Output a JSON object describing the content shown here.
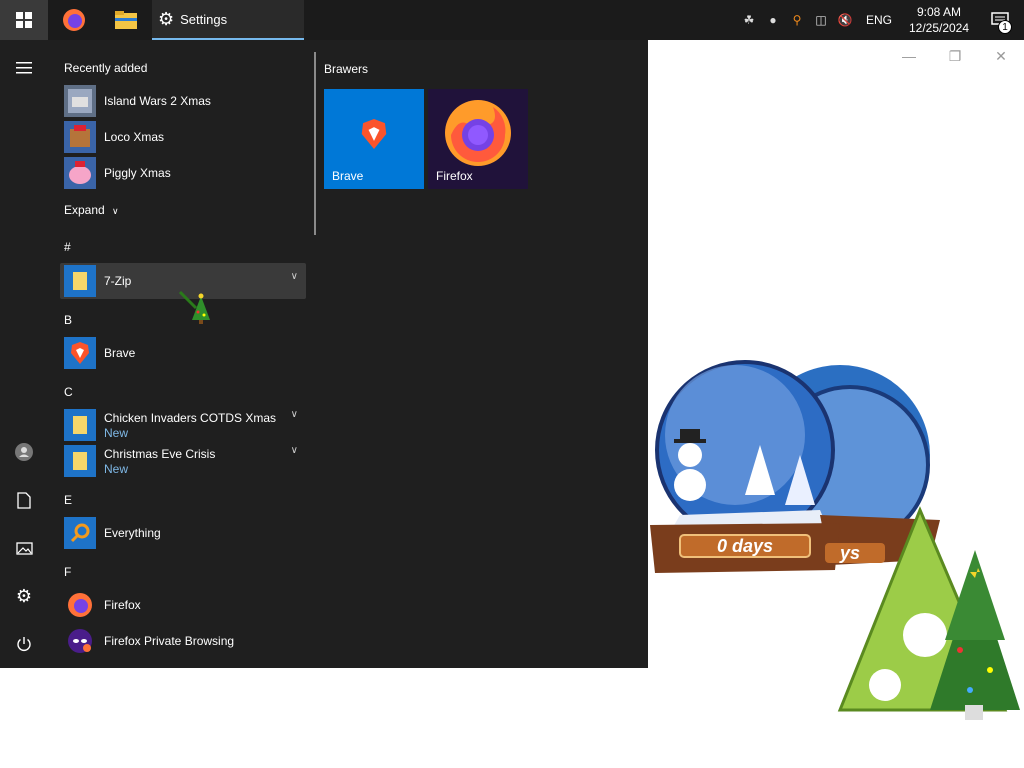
{
  "taskbar": {
    "settings_label": "Settings",
    "language": "ENG",
    "time": "9:08 AM",
    "date": "12/25/2024",
    "notification_count": "1"
  },
  "start_menu": {
    "recently_added_title": "Recently added",
    "recent": [
      {
        "name": "Island Wars 2 Xmas"
      },
      {
        "name": "Loco Xmas"
      },
      {
        "name": "Piggly Xmas"
      }
    ],
    "expand_label": "Expand",
    "letters": {
      "hash": "#",
      "b": "B",
      "c": "C",
      "e": "E",
      "f": "F"
    },
    "apps": {
      "sevenzip": "7-Zip",
      "brave": "Brave",
      "chicken": "Chicken Invaders COTDS Xmas",
      "chicken_sub": "New",
      "christmas": "Christmas Eve Crisis",
      "christmas_sub": "New",
      "everything": "Everything",
      "firefox": "Firefox",
      "firefox_private": "Firefox Private Browsing"
    },
    "tile_group_title": "Brawers",
    "tiles": {
      "brave": "Brave",
      "firefox": "Firefox"
    }
  },
  "desktop_gadget": {
    "globe_text": "0 days",
    "globe_text_back": "ys"
  }
}
